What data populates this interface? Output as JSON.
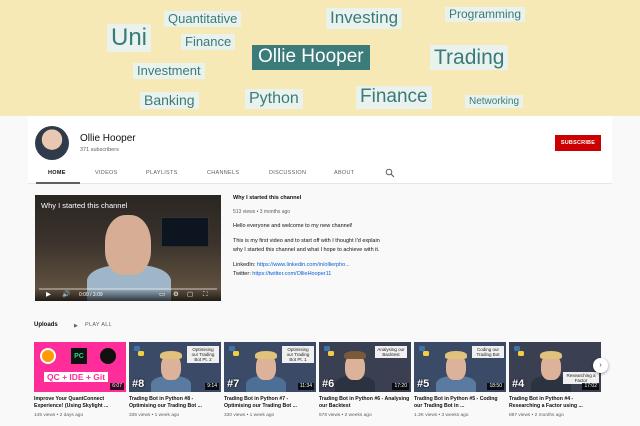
{
  "banner": {
    "tags": [
      "Uni",
      "Quantitative",
      "Finance",
      "Investing",
      "Programming",
      "Ollie Hooper",
      "Trading",
      "Investment",
      "Banking",
      "Python",
      "Finance",
      "Networking"
    ]
  },
  "channel": {
    "name": "Ollie Hooper",
    "subscribers": "371 subscribers",
    "subscribe_label": "SUBSCRIBE"
  },
  "tabs": [
    "HOME",
    "VIDEOS",
    "PLAYLISTS",
    "CHANNELS",
    "DISCUSSION",
    "ABOUT"
  ],
  "featured": {
    "player_title": "Why I started this channel",
    "time": "0:00 / 3:09",
    "title": "Why I started this channel",
    "meta": "513 views • 3 months ago",
    "line1": "Hello everyone and welcome to my new channel!",
    "line2": "This is my first video and to start off with I thought I'd explain",
    "line3": "why I started this channel and what I hope to achieve with it.",
    "linkedin_label": "LinkedIn:",
    "linkedin_url": "https://www.linkedin.com/in/ollierpho...",
    "twitter_label": "Twitter:",
    "twitter_url": "https://twitter.com/OllieHooper11"
  },
  "uploads": {
    "title": "Uploads",
    "play_all": "PLAY ALL",
    "videos": [
      {
        "thumb_text": "QC + IDE + Git",
        "duration": "6:07",
        "title": "Improve Your QuantConnect Experience! (Using Skylight ...",
        "meta": "145 views • 2 days ago",
        "bg": "#ff2d9a"
      },
      {
        "num": "#8",
        "label": "Optimising our Trading Bot Pt. 2",
        "duration": "9:14",
        "title": "Trading Bot in Python #8 - Optimising our Trading Bot ...",
        "meta": "335 views • 1 week ago",
        "bg": "#3b4a66"
      },
      {
        "num": "#7",
        "label": "Optimising our Trading Bot Pt. 1",
        "duration": "11:34",
        "title": "Trading Bot in Python #7 - Optimising our Trading Bot ...",
        "meta": "330 views • 1 week ago",
        "bg": "#3b4a66"
      },
      {
        "num": "#6",
        "label": "Analysing our Backtest",
        "duration": "17:20",
        "title": "Trading Bot in Python #6 - Analysing our Backtest",
        "meta": "578 views • 2 weeks ago",
        "bg": "#3a3f52"
      },
      {
        "num": "#5",
        "label": "Coding our Trading Bot",
        "duration": "18:50",
        "title": "Trading Bot in Python #5 - Coding our Trading Bot in ...",
        "meta": "1.3K views • 3 weeks ago",
        "bg": "#3b4a66"
      },
      {
        "num": "#4",
        "label": "Researching a Factor",
        "duration": "17:02",
        "title": "Trading Bot in Python #4 - Researching a Factor using ...",
        "meta": "887 views • 2 months ago",
        "bg": "#3a3f52"
      }
    ]
  },
  "colors": {
    "brand_red": "#cc0000",
    "banner": "#f7e9b6",
    "tag_highlight": "#3b7b7a"
  }
}
